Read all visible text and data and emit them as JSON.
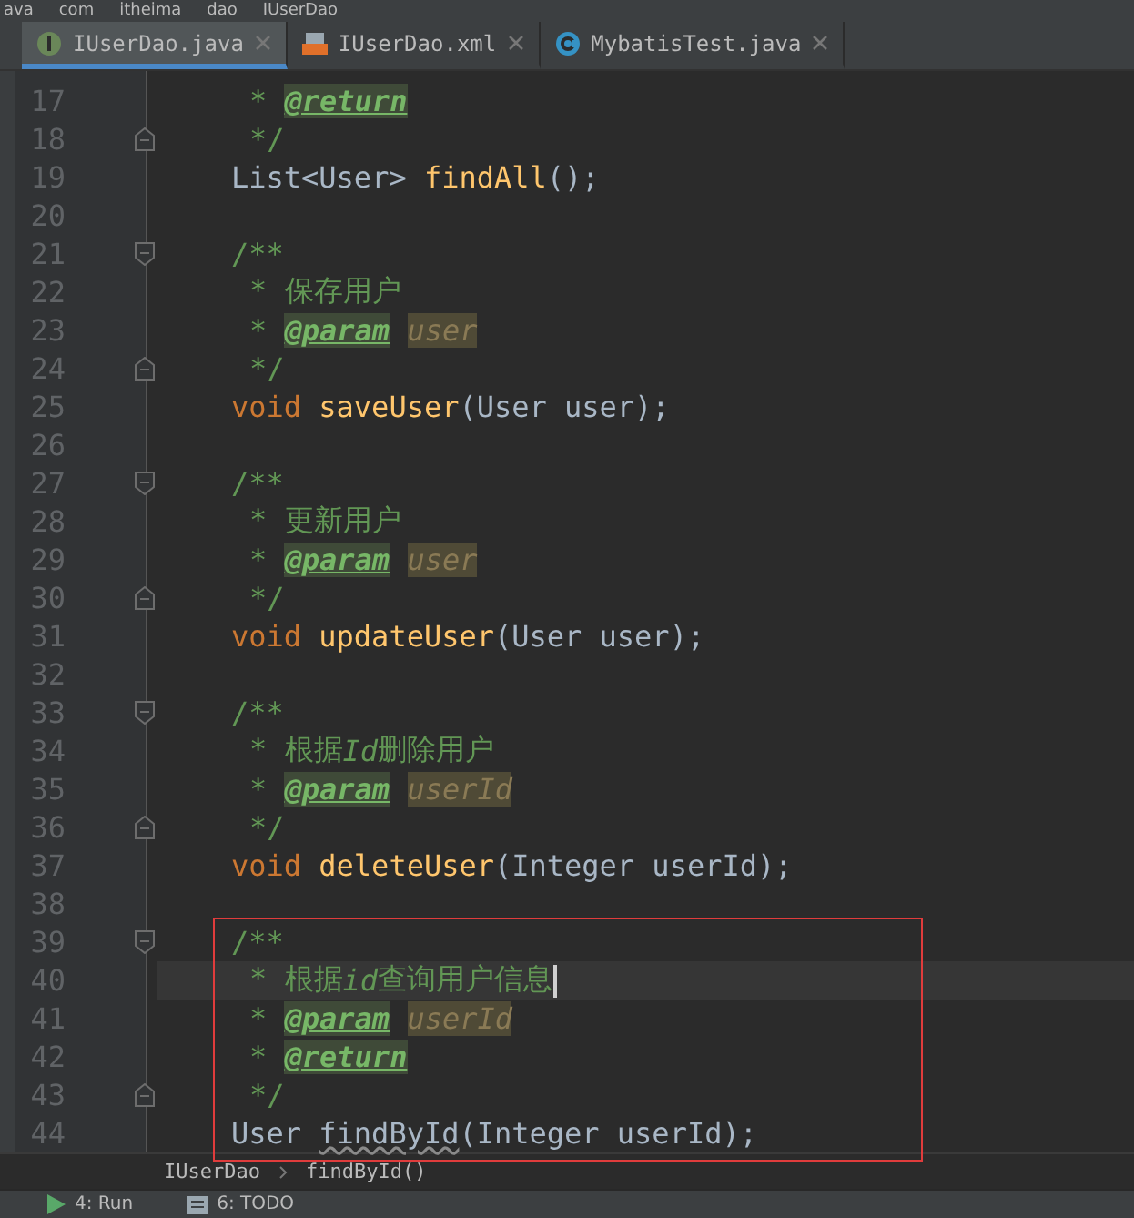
{
  "breadcrumb_top": [
    "ava",
    "com",
    "itheima",
    "dao",
    "IUserDao"
  ],
  "tabs": [
    {
      "label": "IUserDao.java",
      "kind": "interface",
      "selected": true
    },
    {
      "label": "IUserDao.xml",
      "kind": "xml",
      "selected": false
    },
    {
      "label": "MybatisTest.java",
      "kind": "class",
      "selected": false
    }
  ],
  "lines": [
    {
      "number": "17",
      "kind": "doc",
      "fold_start": false,
      "fold_end": false,
      "current": false,
      "tokens": [
        {
          "kind": "comment",
          "text": "*"
        },
        {
          "kind": "tag",
          "text": "@return"
        }
      ]
    },
    {
      "number": "18",
      "kind": "doc",
      "fold_start": false,
      "fold_end": true,
      "current": false,
      "tokens": [
        {
          "kind": "comment",
          "text": "*/"
        }
      ]
    },
    {
      "number": "19",
      "kind": "code",
      "fold_start": false,
      "fold_end": false,
      "current": false,
      "tokens": [
        {
          "kind": "plain",
          "text": "List<User>"
        },
        {
          "kind": "fn",
          "text": "findAll"
        },
        {
          "kind": "plain",
          "text": "();"
        }
      ]
    },
    {
      "number": "20",
      "kind": "blank",
      "fold_start": false,
      "fold_end": false,
      "current": false
    },
    {
      "number": "21",
      "kind": "code",
      "fold_start": true,
      "fold_end": false,
      "current": false,
      "tokens": [
        {
          "kind": "comment",
          "text": "/**"
        }
      ]
    },
    {
      "number": "22",
      "kind": "doc",
      "fold_start": false,
      "fold_end": false,
      "current": false,
      "tokens": [
        {
          "kind": "comment",
          "text": "* 保存用户"
        }
      ]
    },
    {
      "number": "23",
      "kind": "doc",
      "fold_start": false,
      "fold_end": false,
      "current": false,
      "tokens": [
        {
          "kind": "comment",
          "text": "*"
        },
        {
          "kind": "tag",
          "text": "@param"
        },
        {
          "kind": "param",
          "text": "user"
        }
      ]
    },
    {
      "number": "24",
      "kind": "doc",
      "fold_start": false,
      "fold_end": true,
      "current": false,
      "tokens": [
        {
          "kind": "comment",
          "text": "*/"
        }
      ]
    },
    {
      "number": "25",
      "kind": "code",
      "fold_start": false,
      "fold_end": false,
      "current": false,
      "tokens": [
        {
          "kind": "kw",
          "text": "void"
        },
        {
          "kind": "fn",
          "text": "saveUser"
        },
        {
          "kind": "plain",
          "text": "(User user);"
        }
      ]
    },
    {
      "number": "26",
      "kind": "blank",
      "fold_start": false,
      "fold_end": false,
      "current": false
    },
    {
      "number": "27",
      "kind": "code",
      "fold_start": true,
      "fold_end": false,
      "current": false,
      "tokens": [
        {
          "kind": "comment",
          "text": "/**"
        }
      ]
    },
    {
      "number": "28",
      "kind": "doc",
      "fold_start": false,
      "fold_end": false,
      "current": false,
      "tokens": [
        {
          "kind": "comment",
          "text": "* 更新用户"
        }
      ]
    },
    {
      "number": "29",
      "kind": "doc",
      "fold_start": false,
      "fold_end": false,
      "current": false,
      "tokens": [
        {
          "kind": "comment",
          "text": "*"
        },
        {
          "kind": "tag",
          "text": "@param"
        },
        {
          "kind": "param",
          "text": "user"
        }
      ]
    },
    {
      "number": "30",
      "kind": "doc",
      "fold_start": false,
      "fold_end": true,
      "current": false,
      "tokens": [
        {
          "kind": "comment",
          "text": "*/"
        }
      ]
    },
    {
      "number": "31",
      "kind": "code",
      "fold_start": false,
      "fold_end": false,
      "current": false,
      "tokens": [
        {
          "kind": "kw",
          "text": "void"
        },
        {
          "kind": "fn",
          "text": "updateUser"
        },
        {
          "kind": "plain",
          "text": "(User user);"
        }
      ]
    },
    {
      "number": "32",
      "kind": "blank",
      "fold_start": false,
      "fold_end": false,
      "current": false
    },
    {
      "number": "33",
      "kind": "code",
      "fold_start": true,
      "fold_end": false,
      "current": false,
      "tokens": [
        {
          "kind": "comment",
          "text": "/**"
        }
      ]
    },
    {
      "number": "34",
      "kind": "doc",
      "fold_start": false,
      "fold_end": false,
      "current": false,
      "tokens": [
        {
          "kind": "comment",
          "text": "* 根据"
        },
        {
          "kind": "ital",
          "text": "Id"
        },
        {
          "kind": "comment",
          "text": "删除用户"
        }
      ]
    },
    {
      "number": "35",
      "kind": "doc",
      "fold_start": false,
      "fold_end": false,
      "current": false,
      "tokens": [
        {
          "kind": "comment",
          "text": "*"
        },
        {
          "kind": "tag",
          "text": "@param"
        },
        {
          "kind": "param",
          "text": "userId"
        }
      ]
    },
    {
      "number": "36",
      "kind": "doc",
      "fold_start": false,
      "fold_end": true,
      "current": false,
      "tokens": [
        {
          "kind": "comment",
          "text": "*/"
        }
      ]
    },
    {
      "number": "37",
      "kind": "code",
      "fold_start": false,
      "fold_end": false,
      "current": false,
      "tokens": [
        {
          "kind": "kw",
          "text": "void"
        },
        {
          "kind": "fn",
          "text": "deleteUser"
        },
        {
          "kind": "plain",
          "text": "(Integer userId);"
        }
      ]
    },
    {
      "number": "38",
      "kind": "blank",
      "fold_start": false,
      "fold_end": false,
      "current": false
    },
    {
      "number": "39",
      "kind": "code",
      "fold_start": true,
      "fold_end": false,
      "current": false,
      "tokens": [
        {
          "kind": "comment",
          "text": "/**"
        }
      ]
    },
    {
      "number": "40",
      "kind": "doc",
      "fold_start": false,
      "fold_end": false,
      "current": true,
      "tokens": [
        {
          "kind": "comment",
          "text": "* 根据"
        },
        {
          "kind": "ital",
          "text": "id"
        },
        {
          "kind": "comment",
          "text": "查询用户信息"
        }
      ]
    },
    {
      "number": "41",
      "kind": "doc",
      "fold_start": false,
      "fold_end": false,
      "current": false,
      "tokens": [
        {
          "kind": "comment",
          "text": "*"
        },
        {
          "kind": "tag",
          "text": "@param"
        },
        {
          "kind": "param",
          "text": "userId"
        }
      ]
    },
    {
      "number": "42",
      "kind": "doc",
      "fold_start": false,
      "fold_end": false,
      "current": false,
      "tokens": [
        {
          "kind": "comment",
          "text": "*"
        },
        {
          "kind": "tag",
          "text": "@return"
        }
      ]
    },
    {
      "number": "43",
      "kind": "doc",
      "fold_start": false,
      "fold_end": true,
      "current": false,
      "tokens": [
        {
          "kind": "comment",
          "text": "*/"
        }
      ]
    },
    {
      "number": "44",
      "kind": "code",
      "fold_start": false,
      "fold_end": false,
      "current": false,
      "tokens": [
        {
          "kind": "plain",
          "text": "User"
        },
        {
          "kind": "warn",
          "text": "findById"
        },
        {
          "kind": "plain",
          "text": "(Integer userId);"
        }
      ]
    }
  ],
  "code_breadcrumb": [
    "IUserDao",
    "findById()"
  ],
  "tool_tabs": [
    {
      "label": "4: Run",
      "kind": "run"
    },
    {
      "label": "6: TODO",
      "kind": "todo"
    }
  ]
}
